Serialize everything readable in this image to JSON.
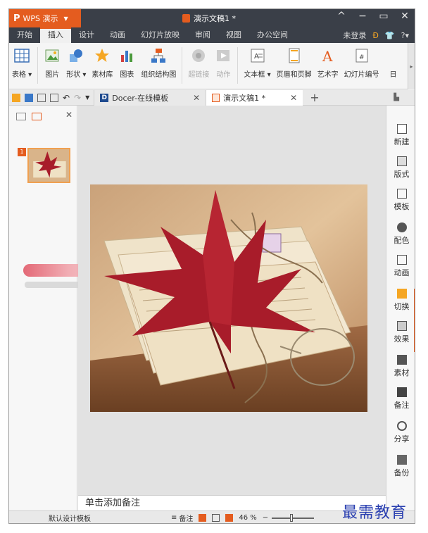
{
  "window": {
    "logo": "P",
    "app_name": "WPS 演示",
    "doc_title": "演示文稿1 *",
    "controls": [
      "^",
      "−",
      "▭",
      "✕"
    ]
  },
  "menu": {
    "tabs": [
      "开始",
      "插入",
      "设计",
      "动画",
      "幻灯片放映",
      "审阅",
      "视图",
      "办公空间"
    ],
    "active": "插入",
    "login": "未登录"
  },
  "ribbon": {
    "items": [
      {
        "label": "表格 ▾",
        "icon": "table-icon"
      },
      {
        "label": "图片",
        "icon": "picture-icon"
      },
      {
        "label": "形状 ▾",
        "icon": "shape-icon"
      },
      {
        "label": "素材库",
        "icon": "star-icon"
      },
      {
        "label": "图表",
        "icon": "chart-icon"
      },
      {
        "label": "组织结构图",
        "icon": "org-chart-icon"
      },
      {
        "label": "超链接",
        "icon": "hyperlink-icon"
      },
      {
        "label": "动作",
        "icon": "action-icon"
      },
      {
        "label": "文本框 ▾",
        "icon": "textbox-icon"
      },
      {
        "label": "页眉和页脚",
        "icon": "header-footer-icon"
      },
      {
        "label": "艺术字",
        "icon": "wordart-icon"
      },
      {
        "label": "幻灯片编号",
        "icon": "slide-number-icon"
      },
      {
        "label": "日",
        "icon": "date-icon"
      }
    ]
  },
  "doc_tabs": [
    {
      "label": "Docer-在线模板",
      "icon": "docer-icon"
    },
    {
      "label": "演示文稿1 *",
      "icon": "ppt-icon"
    }
  ],
  "left_panel": {
    "slide_number": "1"
  },
  "notes_placeholder": "单击添加备注",
  "right_bar": [
    {
      "label": "新建",
      "icon": "new-icon"
    },
    {
      "label": "版式",
      "icon": "layout-icon"
    },
    {
      "label": "模板",
      "icon": "template-icon"
    },
    {
      "label": "配色",
      "icon": "color-scheme-icon"
    },
    {
      "label": "动画",
      "icon": "animation-icon"
    },
    {
      "label": "切换",
      "icon": "transition-icon"
    },
    {
      "label": "效果",
      "icon": "effect-icon"
    },
    {
      "label": "素材",
      "icon": "material-icon"
    },
    {
      "label": "备注",
      "icon": "notes-icon"
    },
    {
      "label": "分享",
      "icon": "share-icon"
    },
    {
      "label": "备份",
      "icon": "backup-icon"
    }
  ],
  "status": {
    "template": "默认设计模板",
    "notes_btn": "备注",
    "zoom": "46 %",
    "zoom_fraction": 0.46
  },
  "watermark": "最需教育",
  "colors": {
    "accent": "#e45c1f",
    "titlebar": "#3a3f48"
  }
}
